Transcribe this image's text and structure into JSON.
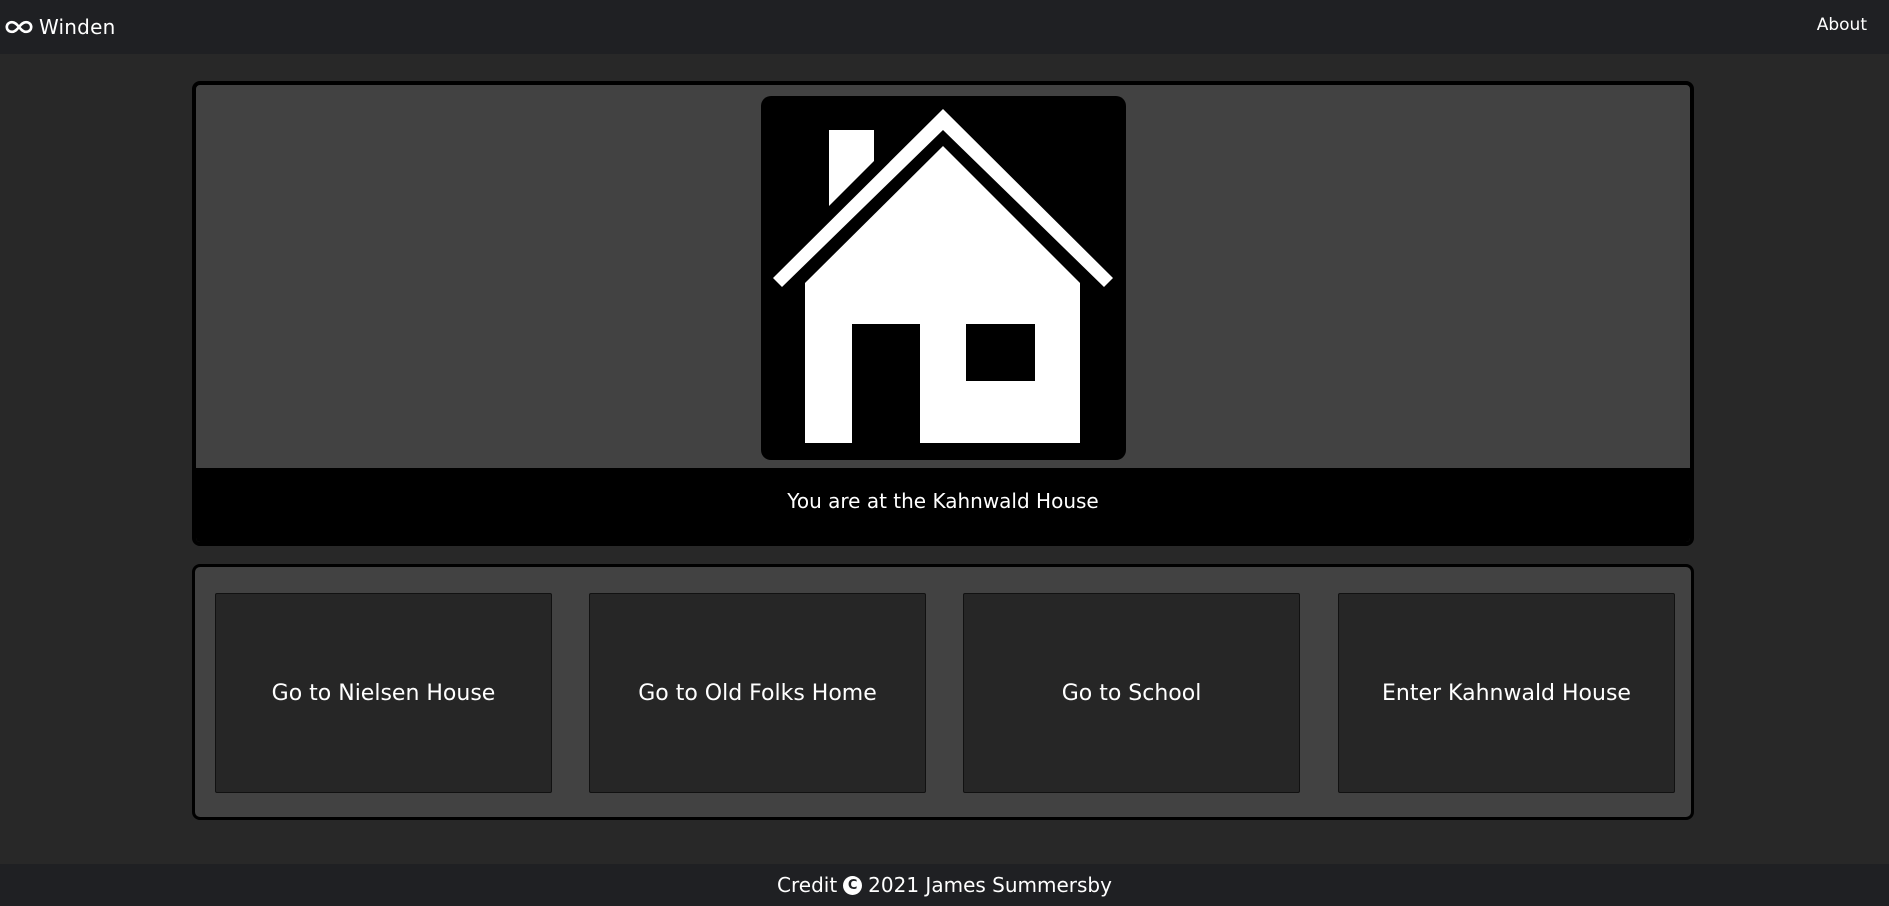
{
  "navbar": {
    "brand": "Winden",
    "brand_icon": "infinity-icon",
    "about_link": "About"
  },
  "scene": {
    "image_icon": "house-icon",
    "caption": "You are at the Kahnwald House"
  },
  "actions": [
    {
      "label": "Go to Nielsen House"
    },
    {
      "label": "Go to Old Folks Home"
    },
    {
      "label": "Go to School"
    },
    {
      "label": "Enter Kahnwald House"
    }
  ],
  "footer": {
    "credit": "Credit",
    "copyright_symbol": "C",
    "year_author": "2021 James Summersby"
  },
  "colors": {
    "page_background": "#282828",
    "navbar_background": "#1f2023",
    "panel_background": "#424242",
    "button_background": "#262626",
    "text": "#ffffff"
  }
}
